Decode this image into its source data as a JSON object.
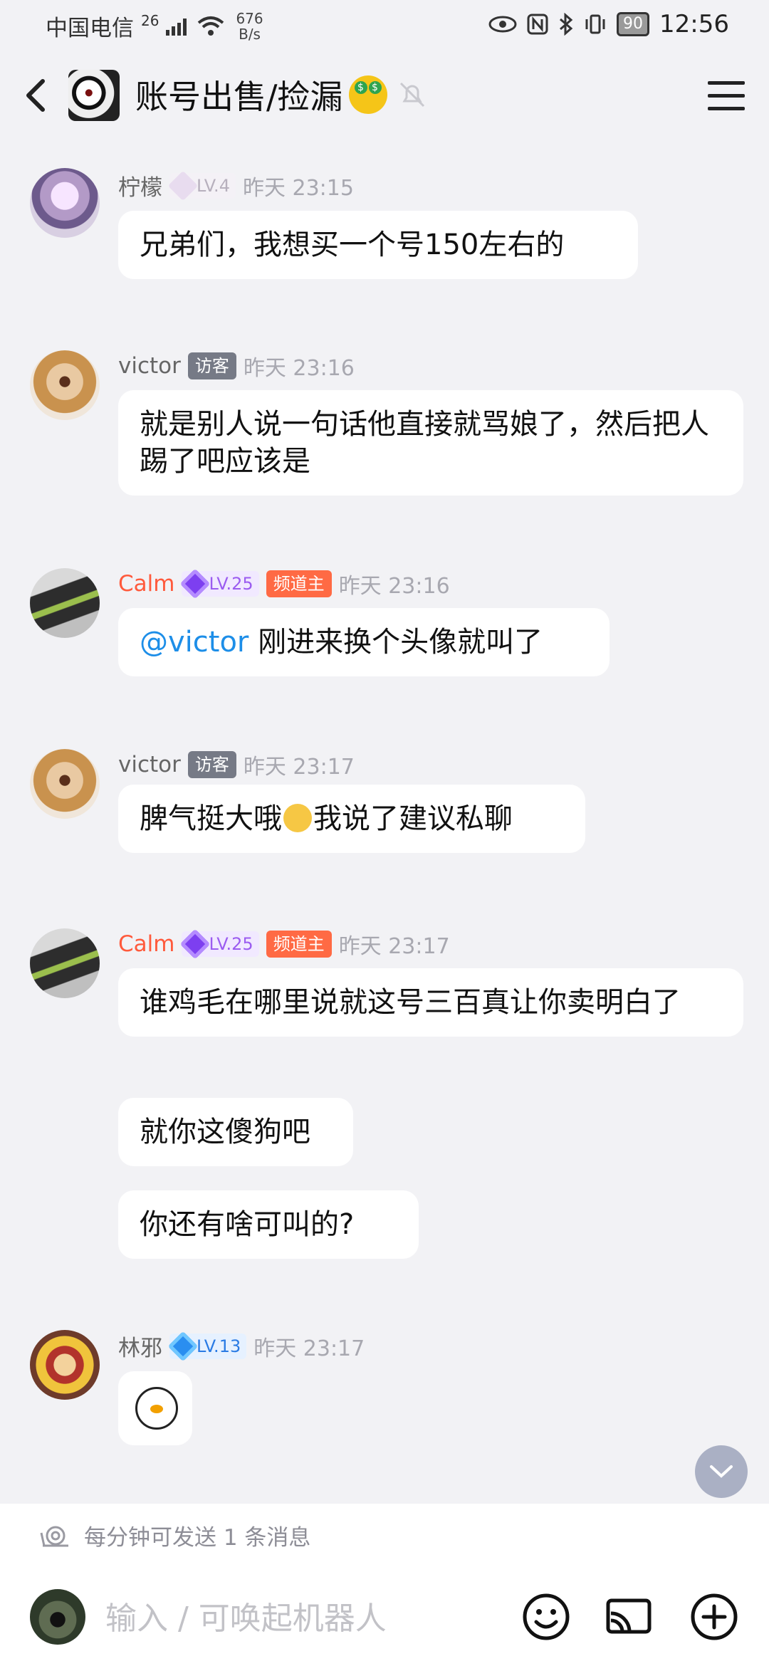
{
  "status_bar": {
    "carrier": "中国电信",
    "signal": "26",
    "speed_value": "676",
    "speed_unit": "B/s",
    "battery": "90",
    "time": "12:56"
  },
  "header": {
    "title": "账号出售/捡漏",
    "title_emoji": "money-mouth-face"
  },
  "messages": [
    {
      "user": "柠檬",
      "level": "LV.4",
      "badge": "",
      "time": "昨天 23:15",
      "bubbles": [
        "兄弟们，我想买一个号150左右的"
      ]
    },
    {
      "user": "victor",
      "level": "",
      "badge": "访客",
      "time": "昨天 23:16",
      "bubbles": [
        "就是别人说一句话他直接就骂娘了，然后把人踢了吧应该是"
      ]
    },
    {
      "user": "Calm",
      "level": "LV.25",
      "badge": "频道主",
      "time": "昨天 23:16",
      "mention": "@victor",
      "bubbles": [
        "刚进来换个头像就叫了"
      ]
    },
    {
      "user": "victor",
      "level": "",
      "badge": "访客",
      "time": "昨天 23:17",
      "bubble_parts": [
        "脾气挺大哦",
        "我说了建议私聊"
      ]
    },
    {
      "user": "Calm",
      "level": "LV.25",
      "badge": "频道主",
      "time": "昨天 23:17",
      "bubbles": [
        "谁鸡毛在哪里说就这号三百真让你卖明白了",
        "就你这傻狗吧",
        "你还有啥可叫的?"
      ]
    },
    {
      "user": "林邪",
      "level": "LV.13",
      "badge": "",
      "time": "昨天 23:17",
      "sticker": "qq-penguin"
    }
  ],
  "composer": {
    "slow_mode_text": "每分钟可发送 1 条消息",
    "placeholder": "输入 / 可唤起机器人"
  }
}
